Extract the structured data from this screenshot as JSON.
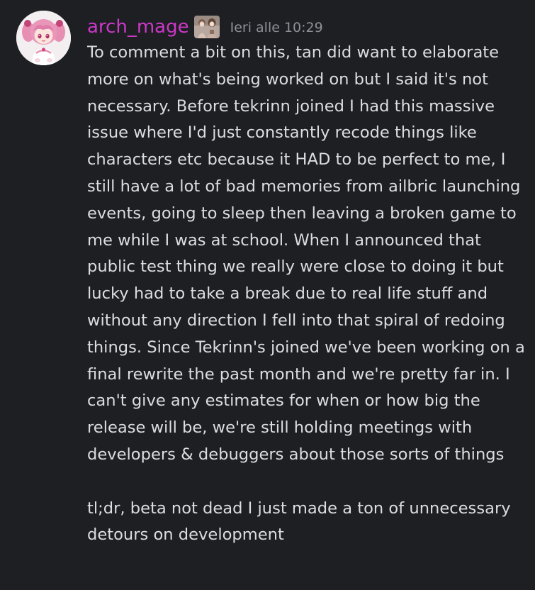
{
  "message": {
    "author": "arch_mage",
    "avatar_icon": "anime-girl-avatar",
    "role_icon": "character-badge-icon",
    "timestamp": "Ieri alle 10:29",
    "paragraph_1": "To comment a bit on this, tan did want to elaborate more on what's being worked on but I said it's not necessary. Before tekrinn joined I had this massive issue where I'd just constantly recode things like characters etc because it HAD to be perfect to me, I still have a lot of bad memories from ailbric launching events, going to sleep then leaving a broken game to me while I was at school. When I announced that public test thing we really were close to doing it but lucky had to take a break due to real life stuff and without any direction I fell into that spiral of redoing things. Since Tekrinn's joined we've been working on a final rewrite the past month and we're pretty far in. I can't give any estimates for when or how big the release will be, we're still holding meetings with developers & debuggers about those sorts of things",
    "paragraph_2": "tl;dr, beta not dead I just made a ton of unnecessary detours on development"
  },
  "colors": {
    "background": "#1e1f23",
    "username": "#cc38c8",
    "timestamp": "#8e9097",
    "text": "#dbdee1"
  }
}
